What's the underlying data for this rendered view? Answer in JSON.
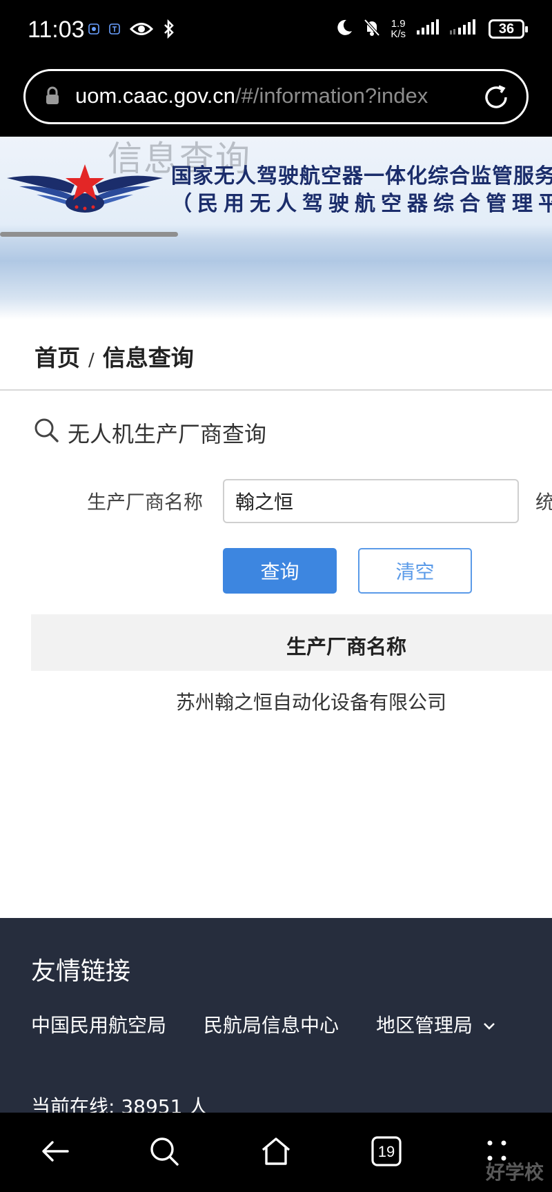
{
  "status_bar": {
    "time": "11:03",
    "net_speed_value": "1.9",
    "net_speed_unit": "K/s",
    "battery": "36",
    "icons": [
      "app-icon",
      "app-icon-t",
      "eye-icon",
      "bluetooth-icon",
      "moon-icon",
      "bell-off-icon",
      "signal-icon",
      "signal-icon",
      "battery-icon"
    ]
  },
  "browser": {
    "url_host": "uom.caac.gov.cn",
    "url_rest": "/#/information?index",
    "icons": [
      "lock-icon",
      "reload-icon"
    ]
  },
  "header": {
    "ghost_title": "信息查询",
    "title": "国家无人驾驶航空器一体化综合监管服务",
    "subtitle": "（民用无人驾驶航空器综合管理平"
  },
  "breadcrumb": {
    "home": "首页",
    "separator": "/",
    "current": "信息查询"
  },
  "section": {
    "title": "无人机生产厂商查询"
  },
  "form": {
    "manufacturer_label": "生产厂商名称",
    "manufacturer_value": "翰之恒",
    "clipped_label": "统",
    "query_button": "查询",
    "clear_button": "清空"
  },
  "results": {
    "columns": [
      "生产厂商名称"
    ],
    "rows": [
      [
        "苏州翰之恒自动化设备有限公司"
      ]
    ]
  },
  "footer": {
    "title": "友情链接",
    "links": [
      "中国民用航空局",
      "民航局信息中心",
      "地区管理局"
    ],
    "online_label": "当前在线:",
    "online_count": "38951",
    "online_unit": "人"
  },
  "nav_bar": {
    "tabs_count": "19",
    "icons": [
      "back-icon",
      "search-icon",
      "home-icon",
      "tabs-icon",
      "menu-icon"
    ]
  },
  "watermark": "好学校",
  "colors": {
    "primary": "#3d86e0",
    "footer_bg": "#262d3d",
    "brand_navy": "#1b2d6b",
    "brand_red": "#e32626"
  }
}
